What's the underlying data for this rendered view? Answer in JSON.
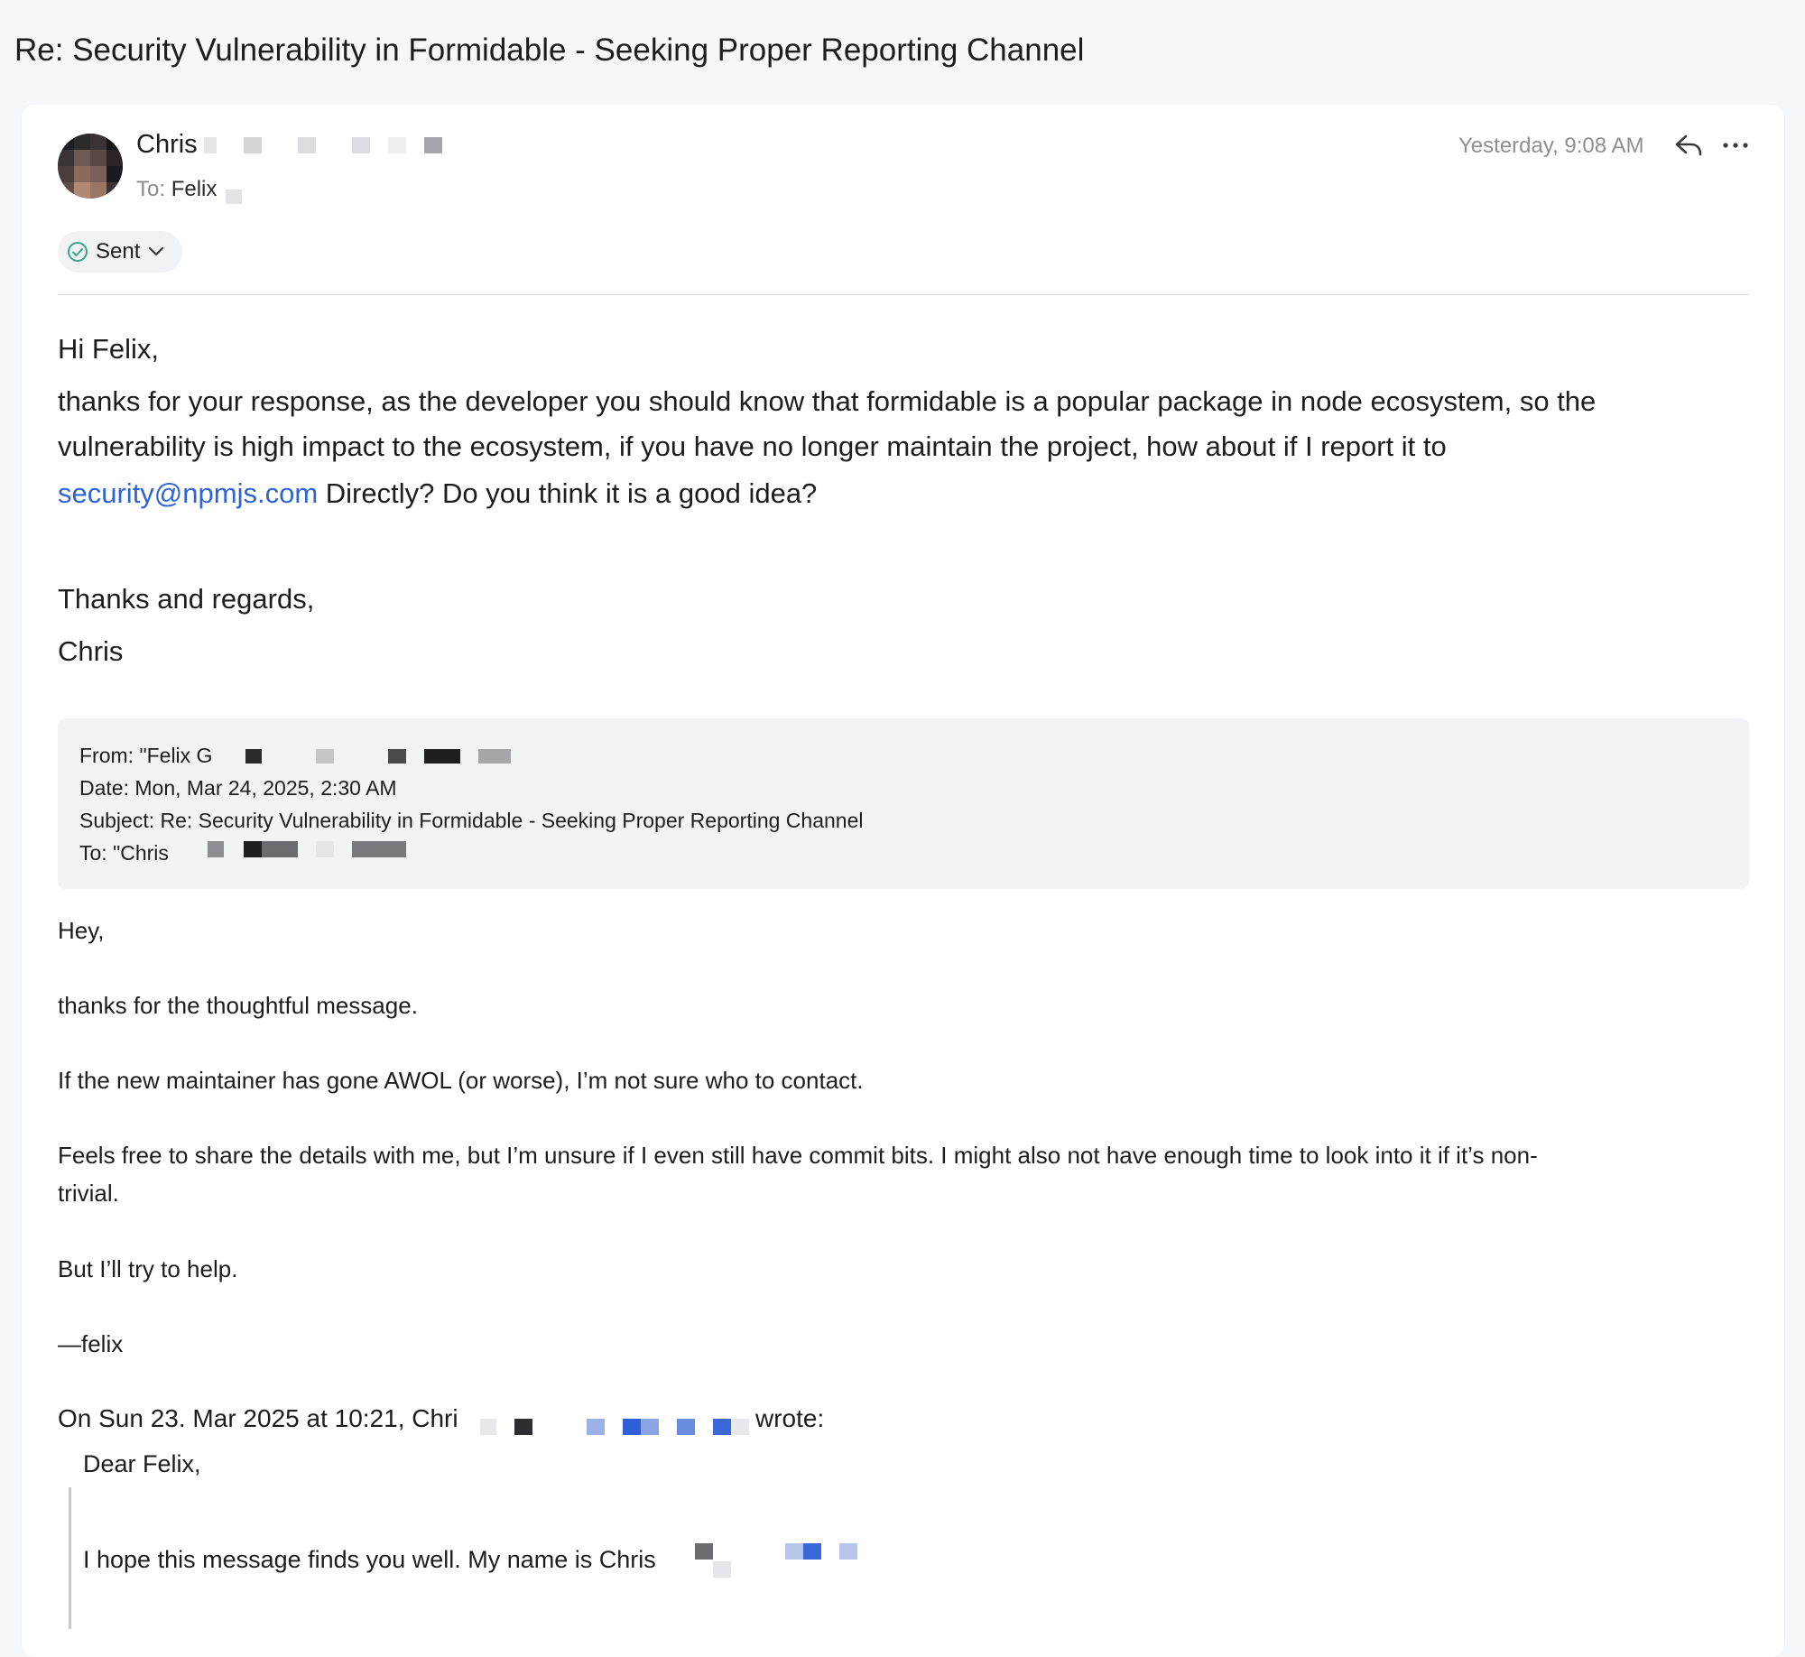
{
  "subject": "Re: Security Vulnerability in Formidable - Seeking Proper Reporting Channel",
  "message": {
    "sender_name": "Chris",
    "to_label": "To:",
    "to_name": "Felix",
    "timestamp": "Yesterday, 9:08 AM",
    "status": "Sent",
    "body": {
      "greeting": "Hi Felix,",
      "line1": "thanks for your response, as the developer you should know that formidable is a popular package in node ecosystem, so the",
      "line2": "vulnerability is high impact to the ecosystem, if you have no longer maintain the project, how about if I report it to",
      "link": "security@npmjs.com",
      "line3_rest": "Directly? Do you think it is a good idea?",
      "closing": "Thanks and regards,",
      "signature": "Chris"
    }
  },
  "quoted_header": {
    "from": "From: \"Felix G",
    "date": "Date: Mon, Mar 24, 2025, 2:30 AM",
    "subject": "Subject: Re: Security Vulnerability in Formidable - Seeking Proper Reporting Channel",
    "to": "To: \"Chris"
  },
  "quoted_reply": {
    "hey": "Hey,",
    "thanks": "thanks for the thoughtful message.",
    "awol": "If the new maintainer has gone AWOL (or worse), I’m not sure who to contact.",
    "feels1": "Feels free to share the details with me, but I’m unsure if I even still have commit bits. I might also not have enough time to look into it if it’s non-",
    "feels2": "trivial.",
    "help": "But I’ll try to help.",
    "sig": "—felix",
    "on_prefix": "On Sun 23. Mar 2025 at 10:21, Chri",
    "on_suffix": "wrote:"
  },
  "nested_quote": {
    "dear": "Dear Felix,",
    "hope": "I hope this message finds you well. My name is Chris"
  },
  "colors": {
    "link": "#2f63d8",
    "sent_check": "#3aa58a",
    "background": "#f6f7f9"
  }
}
